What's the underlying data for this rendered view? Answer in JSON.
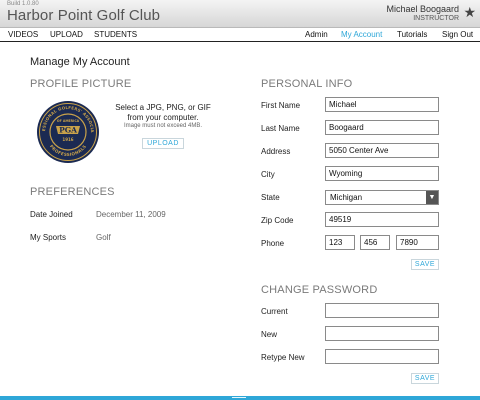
{
  "header": {
    "build": "Build 1.0.80",
    "title": "Harbor Point Golf Club",
    "user_name": "Michael Boogaard",
    "user_role": "INSTRUCTOR"
  },
  "nav": {
    "left": [
      "VIDEOS",
      "UPLOAD",
      "STUDENTS"
    ],
    "right": [
      "Admin",
      "My Account",
      "Tutorials",
      "Sign Out"
    ],
    "active": "My Account"
  },
  "page": {
    "title": "Manage My Account"
  },
  "profile_picture": {
    "title": "PROFILE PICTURE",
    "instructions_line1": "Select a JPG, PNG, or GIF",
    "instructions_line2": "from your computer.",
    "note": "Image must not exceed 4MB.",
    "upload_label": "UPLOAD",
    "logo": {
      "text": "PGA",
      "year": "1916",
      "ring_top": "PROFESSIONAL GOLFERS' ASSOCIATION",
      "ring_mid": "OF AMERICA",
      "ring_bottom": "PROFESSIONALS",
      "icon": "pga-logo-icon"
    }
  },
  "preferences": {
    "title": "PREFERENCES",
    "date_joined_label": "Date Joined",
    "date_joined": "December 11, 2009",
    "sports_label": "My Sports",
    "sports": "Golf"
  },
  "personal_info": {
    "title": "PERSONAL INFO",
    "first_name_label": "First Name",
    "first_name": "Michael",
    "last_name_label": "Last Name",
    "last_name": "Boogaard",
    "address_label": "Address",
    "address": "5050 Center Ave",
    "city_label": "City",
    "city": "Wyoming",
    "state_label": "State",
    "state": "Michigan",
    "zip_label": "Zip Code",
    "zip": "49519",
    "phone_label": "Phone",
    "phone_area": "123",
    "phone_prefix": "456",
    "phone_line": "7890",
    "save_label": "SAVE"
  },
  "change_password": {
    "title": "CHANGE PASSWORD",
    "current_label": "Current",
    "new_label": "New",
    "retype_label": "Retype New",
    "save_label": "SAVE"
  },
  "colors": {
    "accent": "#2ea7d8",
    "pga_navy": "#1b2a52",
    "pga_gold": "#c9a24a"
  }
}
